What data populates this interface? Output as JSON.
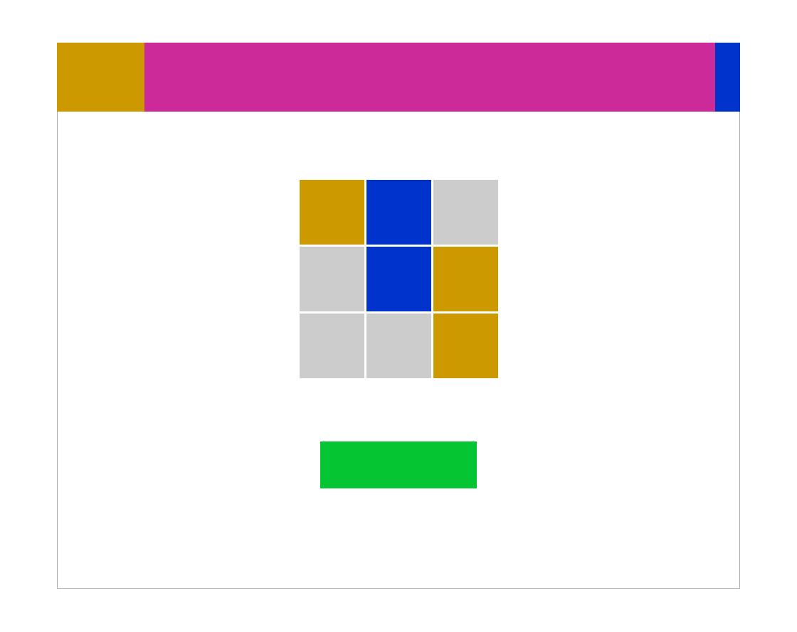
{
  "colors": {
    "gold": "#cc9900",
    "magenta": "#cc2a99",
    "blue": "#0033cc",
    "gray": "#cccccc",
    "green": "#05c632",
    "border": "#aaaaaa"
  },
  "header": {
    "left_color": "#cc9900",
    "center_color": "#cc2a99",
    "right_color": "#0033cc"
  },
  "grid": {
    "rows": 3,
    "cols": 3,
    "cells": [
      "#cc9900",
      "#0033cc",
      "#cccccc",
      "#cccccc",
      "#0033cc",
      "#cc9900",
      "#cccccc",
      "#cccccc",
      "#cc9900"
    ]
  },
  "action_button": {
    "label": "",
    "color": "#05c632"
  }
}
